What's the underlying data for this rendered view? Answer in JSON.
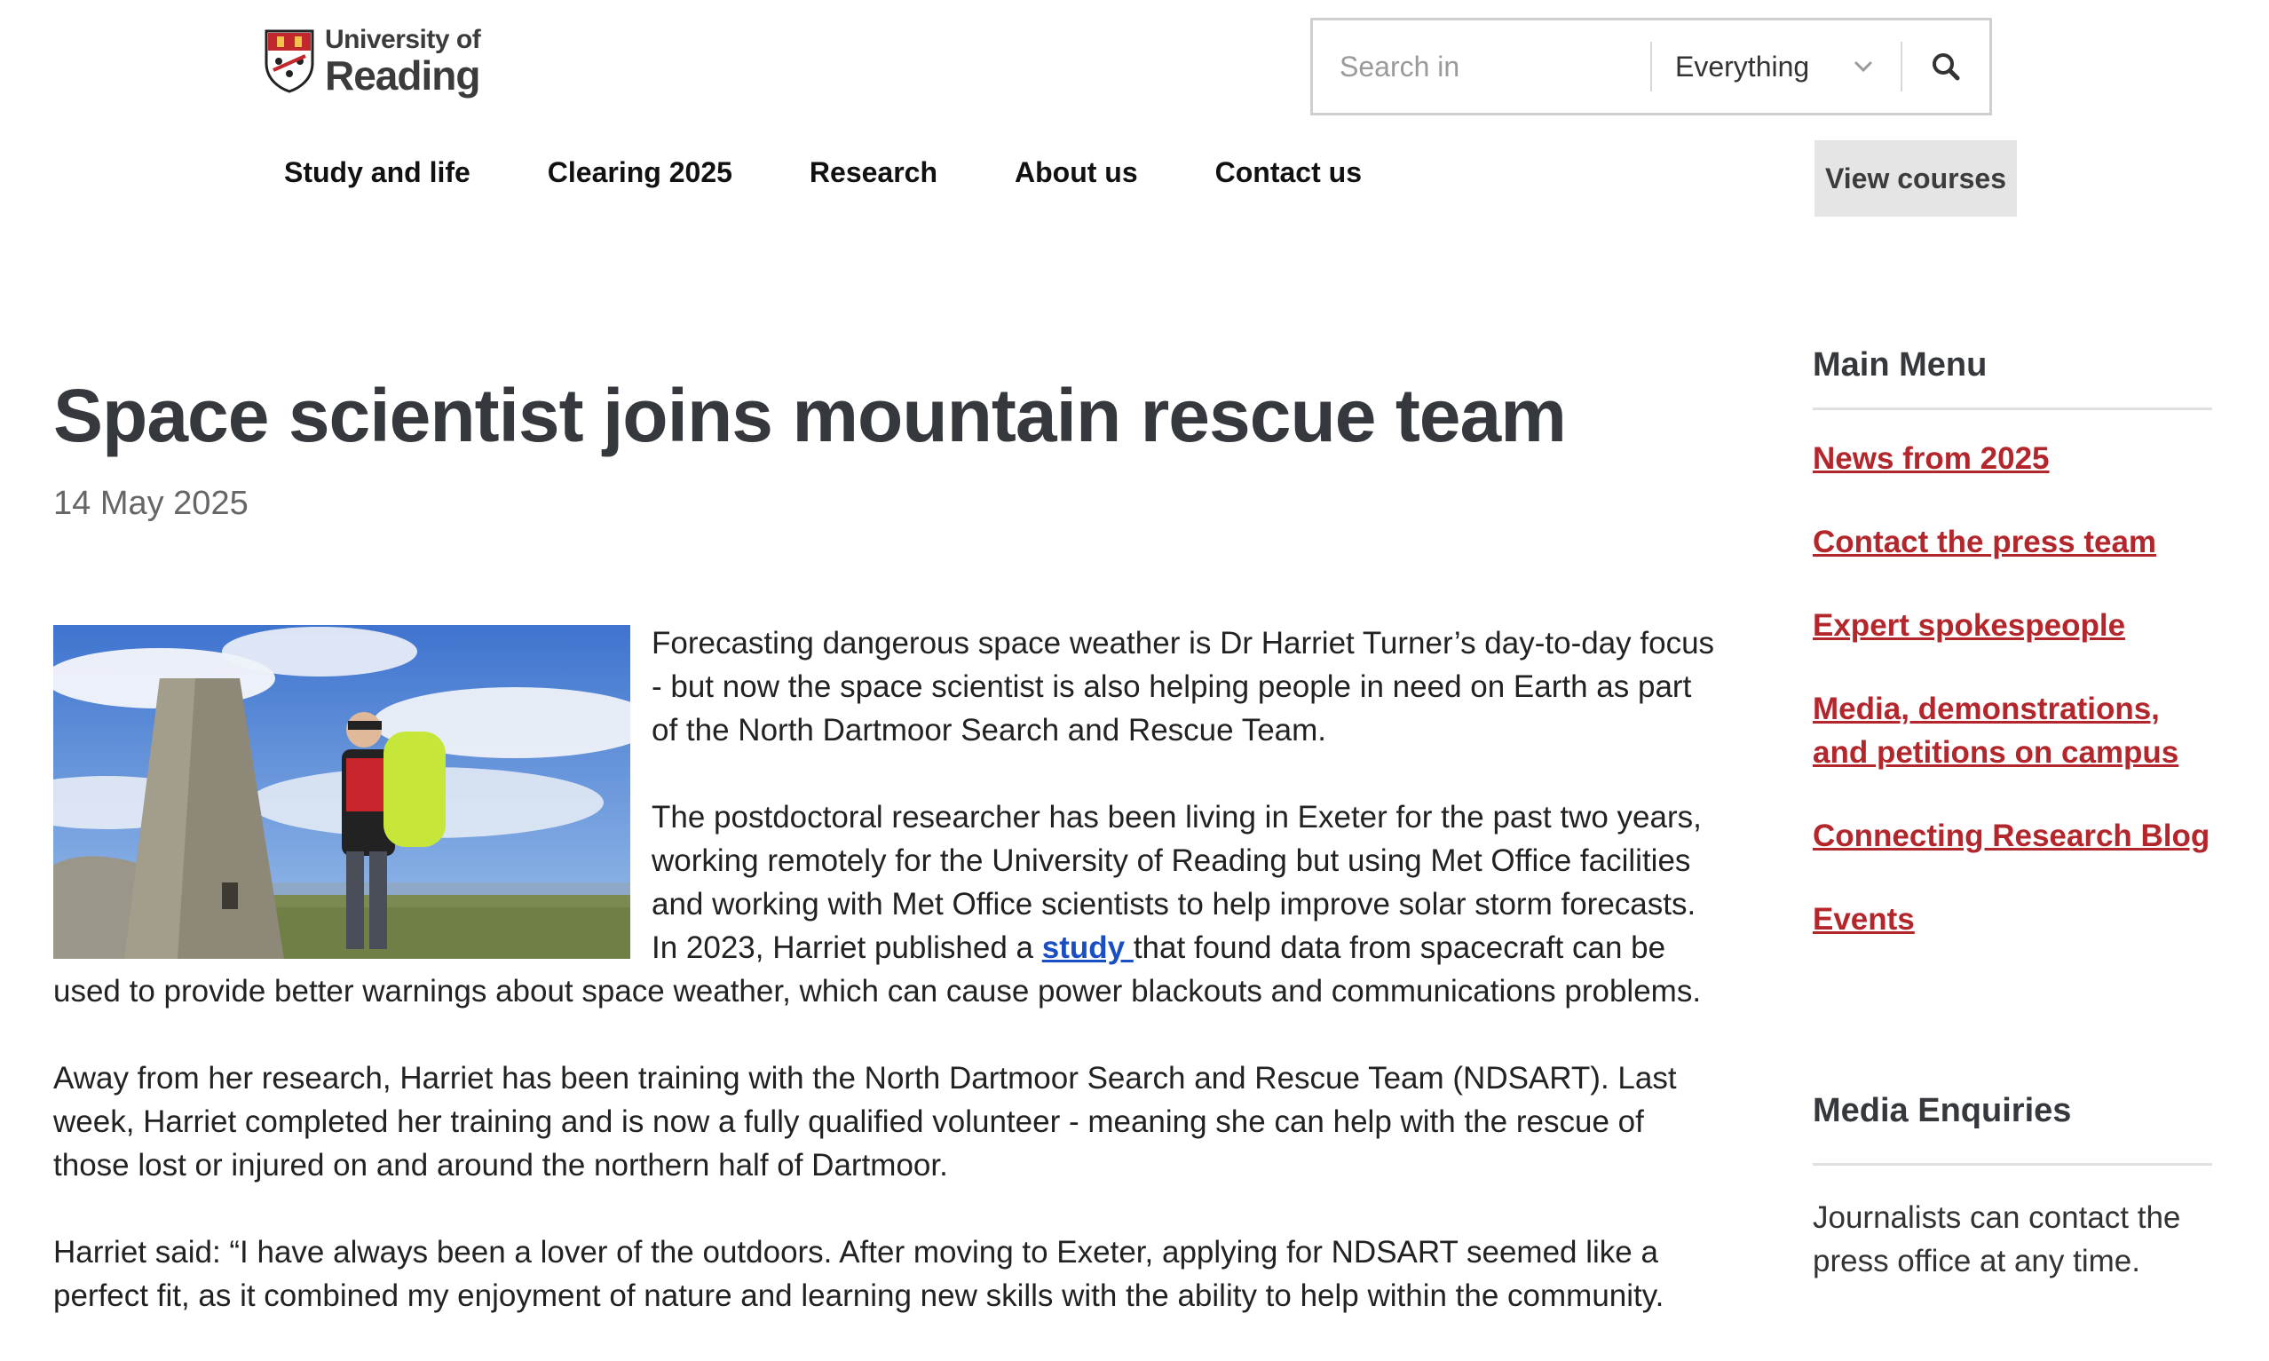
{
  "header": {
    "logo_line1": "University of",
    "logo_line2": "Reading",
    "search": {
      "placeholder": "Search in",
      "scope": "Everything"
    }
  },
  "nav": {
    "items": [
      "Study and life",
      "Clearing 2025",
      "Research",
      "About us",
      "Contact us"
    ],
    "cta": "View courses"
  },
  "article": {
    "title": "Space scientist joins mountain rescue team",
    "date": "14 May 2025",
    "p1": "Forecasting dangerous space weather is Dr Harriet Turner’s day-to-day focus - but now the space scientist is also helping people in need on Earth as part of the North Dartmoor Search and Rescue Team.",
    "p2_before": "The postdoctoral researcher has been living in Exeter for the past two years, working remotely for the University of Reading but using Met Office facilities and working with Met Office scientists to help improve solar storm forecasts. In 2023, Harriet published a ",
    "p2_link": "study ",
    "p2_after": "that found data from spacecraft can be used to provide better warnings about space weather, which can cause power blackouts and communications problems.",
    "p3": "Away from her research, Harriet has been training with the North Dartmoor Search and Rescue Team (NDSART). Last week, Harriet completed her training and is now a fully qualified volunteer - meaning she can help with the rescue of those lost or injured on and around the northern half of Dartmoor.",
    "p4": "Harriet said: “I have always been a lover of the outdoors. After moving to Exeter, applying for NDSART seemed like a perfect fit, as it combined my enjoyment of nature and learning new skills with the ability to help within the community."
  },
  "sidebar": {
    "heading": "Main Menu",
    "links": [
      "News from 2025",
      "Contact the press team",
      "Expert spokespeople",
      "Media, demonstrations, and petitions on campus",
      "Connecting Research Blog",
      "Events"
    ],
    "media_heading": "Media Enquiries",
    "media_text": "Journalists can contact the press office at any time."
  },
  "colors": {
    "link_red": "#b3262b",
    "link_blue": "#1a4fc4",
    "title": "#35383d",
    "button_bg": "#e5e5e5"
  },
  "icons": {
    "logo": "university-crest-icon",
    "dropdown": "chevron-down-icon",
    "search": "search-icon"
  }
}
